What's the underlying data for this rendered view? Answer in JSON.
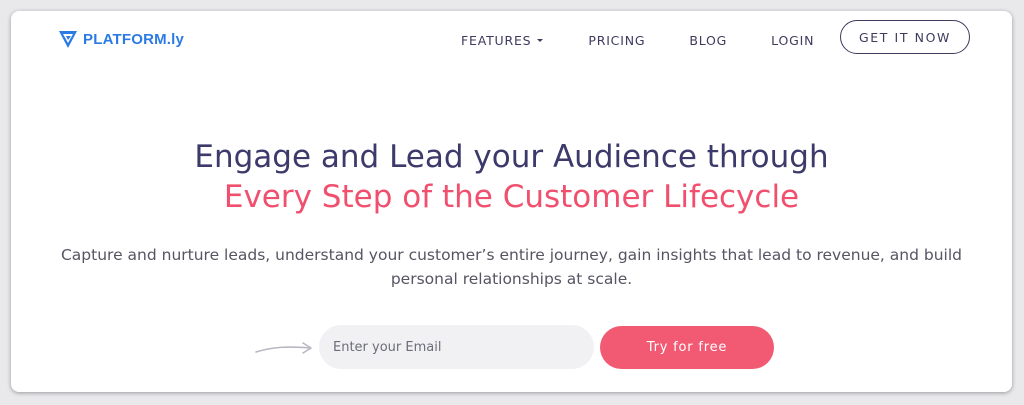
{
  "brand": {
    "logo_text": "PLATFORM.ly",
    "logo_color": "#2c7be5"
  },
  "nav": {
    "items": [
      {
        "label": "FEATURES",
        "has_dropdown": true
      },
      {
        "label": "PRICING"
      },
      {
        "label": "BLOG"
      },
      {
        "label": "LOGIN"
      }
    ],
    "cta_label": "GET IT NOW"
  },
  "hero": {
    "headline_line1": "Engage and Lead your Audience through",
    "headline_line2": "Every Step of the Customer Lifecycle",
    "subtext": "Capture and nurture leads, understand your customer’s entire journey, gain insights that lead to revenue, and build personal relationships at scale."
  },
  "signup": {
    "email_placeholder": "Enter your Email",
    "email_value": "",
    "button_label": "Try for free"
  },
  "colors": {
    "navy": "#3c3a6b",
    "coral": "#f0506e",
    "button": "#f25a74",
    "text": "#555563"
  }
}
